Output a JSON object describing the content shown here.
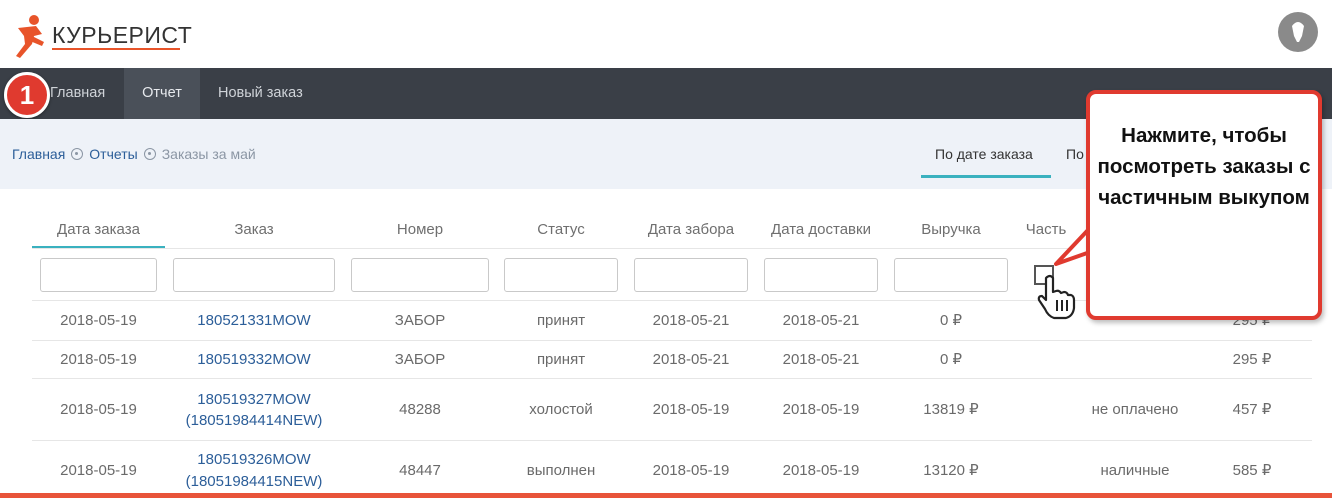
{
  "app": {
    "logo_text": "КУРЬЕРИСТ"
  },
  "nav": {
    "badge": "1",
    "items": [
      {
        "label": "Главная"
      },
      {
        "label": "Отчет"
      },
      {
        "label": "Новый заказ"
      }
    ]
  },
  "breadcrumb": {
    "home": "Главная",
    "reports": "Отчеты",
    "current": "Заказы за май"
  },
  "view_tabs": {
    "by_order_date": "По дате заказа",
    "second": "По"
  },
  "table": {
    "columns": [
      "Дата заказа",
      "Заказ",
      "Номер",
      "Статус",
      "Дата забора",
      "Дата доставки",
      "Выручка",
      "Часть"
    ],
    "rows": [
      {
        "date": "2018-05-19",
        "order": "180521331MOW",
        "order2": "",
        "number": "ЗАБОР",
        "status": "принят",
        "pickup": "2018-05-21",
        "delivery": "2018-05-21",
        "revenue": "0 ₽",
        "payment": "",
        "sum": "295 ₽"
      },
      {
        "date": "2018-05-19",
        "order": "180519332MOW",
        "order2": "",
        "number": "ЗАБОР",
        "status": "принят",
        "pickup": "2018-05-21",
        "delivery": "2018-05-21",
        "revenue": "0 ₽",
        "payment": "",
        "sum": "295 ₽"
      },
      {
        "date": "2018-05-19",
        "order": "180519327MOW",
        "order2": "(18051984414NEW)",
        "number": "48288",
        "status": "холостой",
        "pickup": "2018-05-19",
        "delivery": "2018-05-19",
        "revenue": "13819 ₽",
        "payment": "не оплачено",
        "sum": "457 ₽"
      },
      {
        "date": "2018-05-19",
        "order": "180519326MOW",
        "order2": "(18051984415NEW)",
        "number": "48447",
        "status": "выполнен",
        "pickup": "2018-05-19",
        "delivery": "2018-05-19",
        "revenue": "13120 ₽",
        "payment": "наличные",
        "sum": "585 ₽"
      }
    ]
  },
  "callout": {
    "text": "Нажмите, чтобы посмотреть заказы с частичным выкупом"
  },
  "colors": {
    "accent": "#3ab1bf",
    "nav_bg": "#3a3f47",
    "link": "#2c5e99",
    "highlight": "#e03a2f"
  }
}
